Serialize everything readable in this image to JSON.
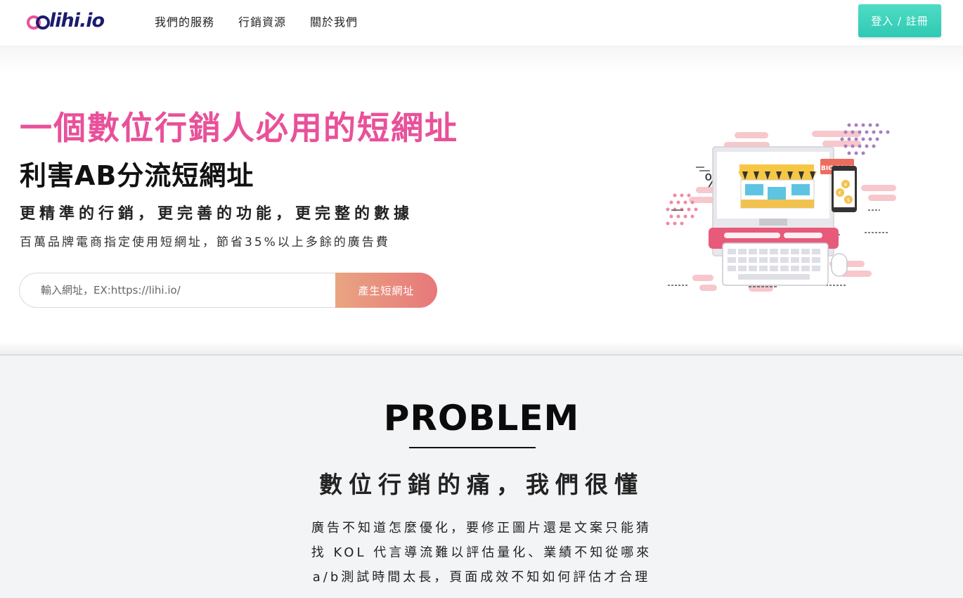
{
  "nav": {
    "logo_text": "lihi.io",
    "links": [
      "我們的服務",
      "行銷資源",
      "關於我們"
    ],
    "login_label": "登入 / 註冊"
  },
  "hero": {
    "title": "一個數位行銷人必用的短網址",
    "subtitle": "利害AB分流短網址",
    "tagline": "更精準的行銷，更完善的功能，更完整的數據",
    "description": "百萬品牌電商指定使用短網址，節省35%以上多餘的廣告費",
    "url_placeholder": "輸入網址，EX:https://lihi.io/",
    "generate_label": "產生短網址",
    "illustration_badge": "BIG SALE",
    "illustration_percent": "%",
    "illustration_coins": [
      "¥",
      "€",
      "$"
    ]
  },
  "problem": {
    "title": "PROBLEM",
    "subtitle": "數位行銷的痛，我們很懂",
    "items": [
      "廣告不知道怎麼優化，要修正圖片還是文案只能猜",
      "找 KOL 代言導流難以評估量化、業績不知從哪來",
      "a/b測試時間太長，頁面成效不知如何評估才合理"
    ]
  },
  "colors": {
    "brand_pink": "#e8519a",
    "brand_navy": "#1b1c6e",
    "login_teal": "#2fc9b3",
    "cta_gradient_start": "#e9a482",
    "cta_gradient_end": "#e7787a"
  }
}
